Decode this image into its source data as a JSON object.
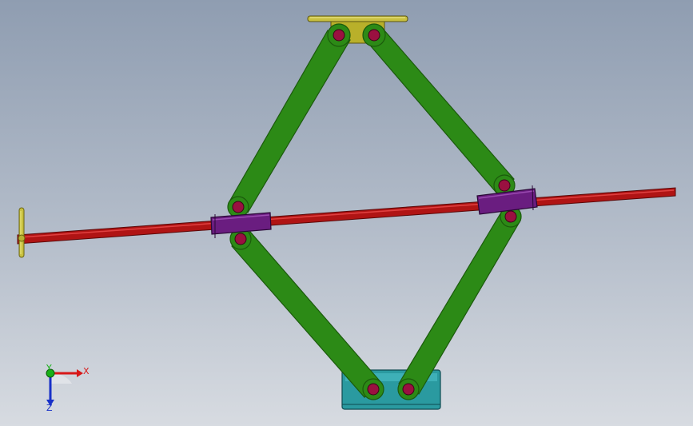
{
  "colors": {
    "background_top": "#8f9db1",
    "background_bottom": "#d7dbe1",
    "screw_rod": "#b01414",
    "screw_rod_highlight": "#e04040",
    "arm": "#2c8a16",
    "arm_dark": "#1b5a0c",
    "nut_block": "#6a1d80",
    "top_plate": "#b9b02a",
    "base": "#2a9aa0",
    "pin": "#9a1040",
    "handle": "#c8c040",
    "axis_x": "#d81818",
    "axis_y": "#18b018",
    "axis_z": "#1830c8"
  },
  "triad": {
    "x_label": "X",
    "y_label": "Y",
    "z_label": "Z"
  }
}
